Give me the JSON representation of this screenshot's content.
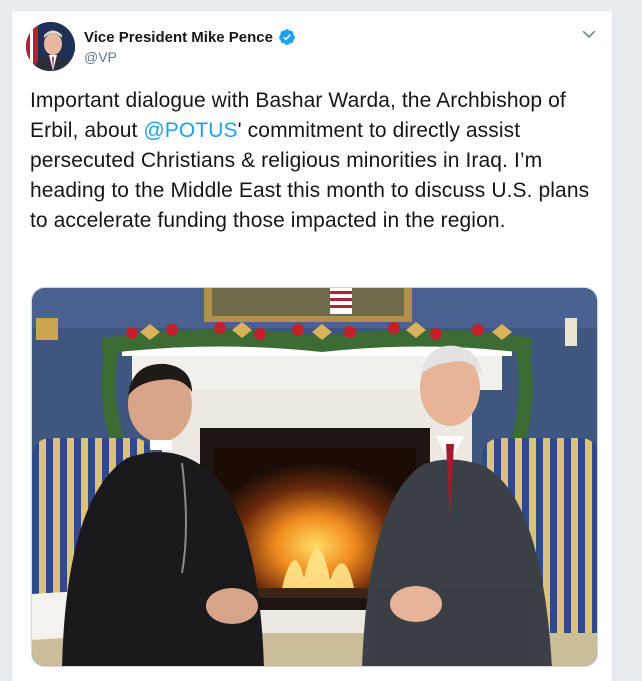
{
  "tweet": {
    "author": {
      "display_name": "Vice President Mike Pence",
      "handle": "@VP",
      "verified": true,
      "avatar_icon": "profile-avatar-icon"
    },
    "menu_icon": "chevron-down-icon",
    "text_before_mention": "Important dialogue with Bashar Warda, the Archbishop of Erbil, about ",
    "mention": "@POTUS",
    "text_after_mention": "' commitment to directly assist persecuted Christians & religious minorities in Iraq. I’m heading to the Middle East this month to discuss U.S. plans to accelerate funding those impacted in the region.",
    "media": {
      "type": "photo",
      "subject": "meeting-photo"
    }
  },
  "colors": {
    "link": "#1da1f2",
    "verified_badge": "#1da1f2",
    "text": "#14171a",
    "secondary_text": "#657786",
    "background": "#e6ecf0"
  }
}
